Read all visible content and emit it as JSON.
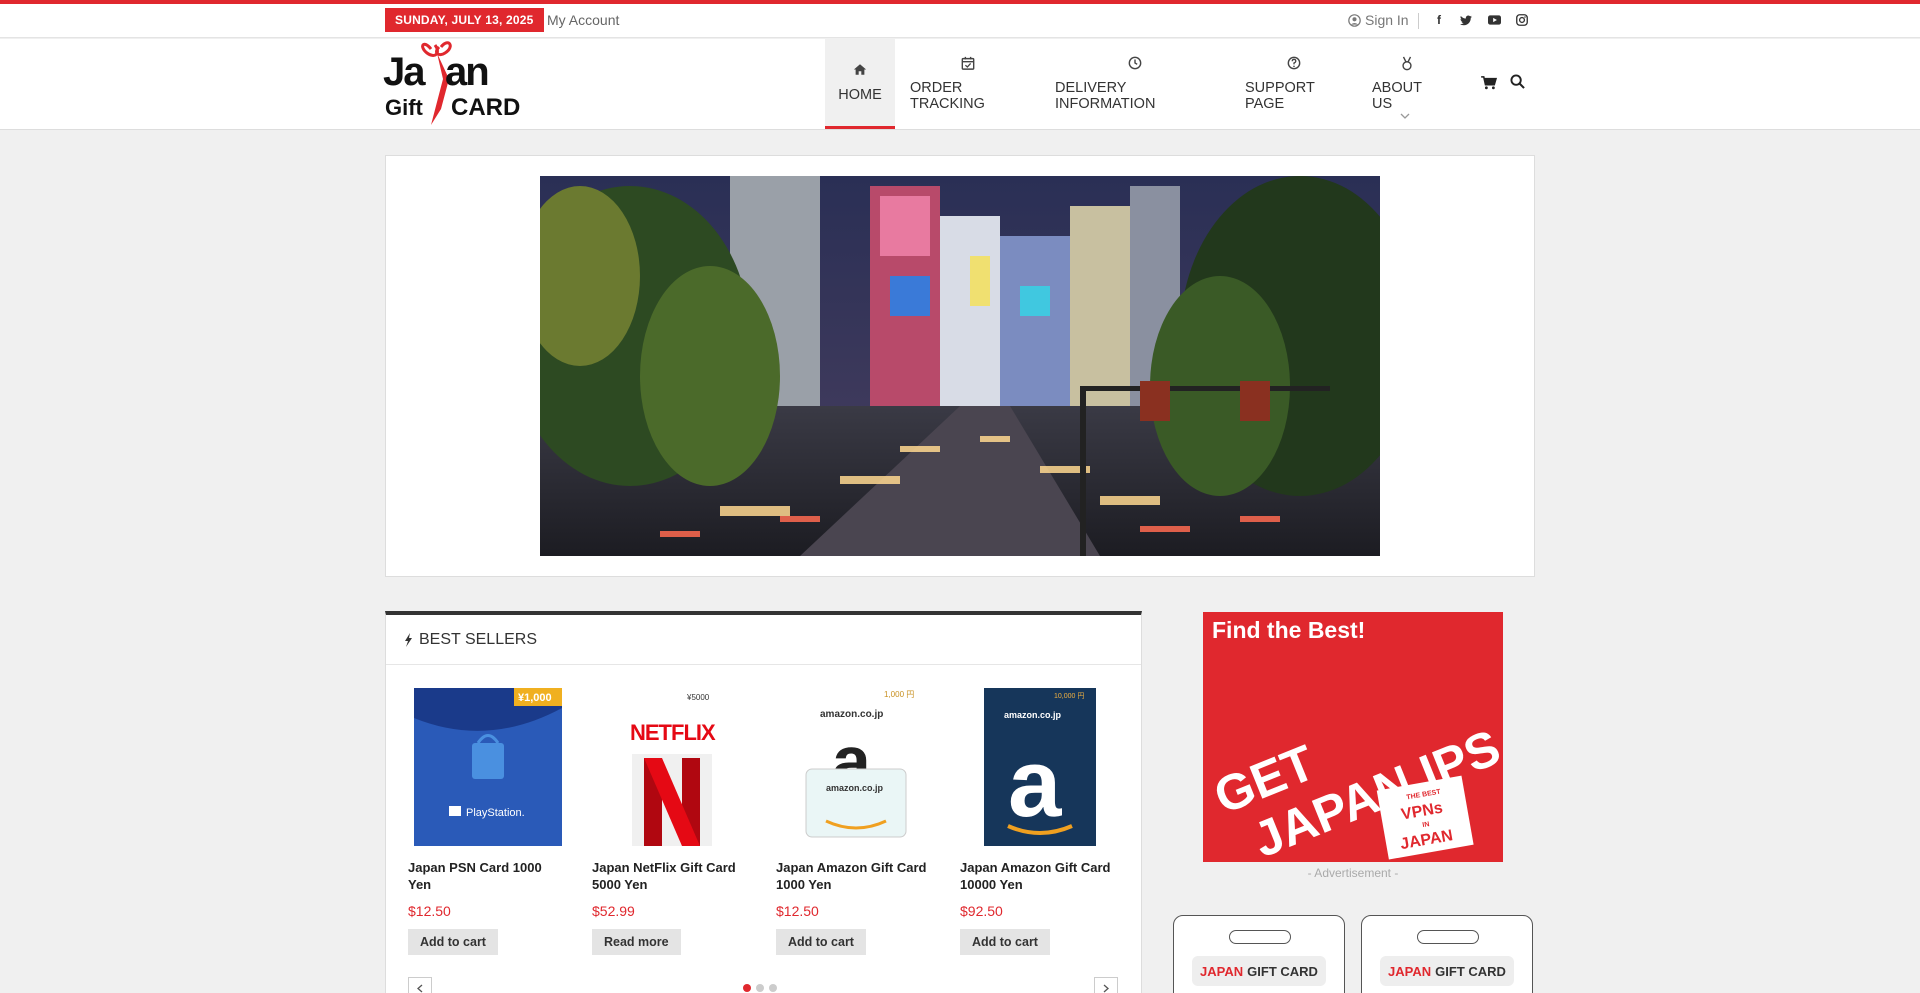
{
  "topbar": {
    "date": "SUNDAY, JULY 13, 2025",
    "my_account": "My Account",
    "sign_in": "Sign In",
    "social": [
      "facebook-icon",
      "twitter-icon",
      "youtube-icon",
      "instagram-icon"
    ]
  },
  "logo": {
    "line1": "Japan",
    "line2_a": "Gift",
    "line2_b": "CARD"
  },
  "nav": {
    "items": [
      {
        "label": "HOME",
        "icon": "home-icon"
      },
      {
        "label": "ORDER TRACKING",
        "icon": "calendar-check-icon"
      },
      {
        "label": "DELIVERY INFORMATION",
        "icon": "clock-icon"
      },
      {
        "label": "SUPPORT PAGE",
        "icon": "question-circle-icon"
      },
      {
        "label": "ABOUT US",
        "icon": "medal-icon"
      }
    ]
  },
  "best_sellers": {
    "title": "BEST SELLERS",
    "products": [
      {
        "name": "Japan PSN Card 1000 Yen",
        "price": "$12.50",
        "button": "Add to cart",
        "badge": "¥1,000"
      },
      {
        "name": "Japan NetFlix Gift Card 5000 Yen",
        "price": "$52.99",
        "button": "Read more",
        "badge": "¥5000"
      },
      {
        "name": "Japan Amazon Gift Card 1000 Yen",
        "price": "$12.50",
        "button": "Add to cart",
        "badge": "1,000 円"
      },
      {
        "name": "Japan Amazon Gift Card 10000 Yen",
        "price": "$92.50",
        "button": "Add to cart",
        "badge": "10,000 円"
      }
    ]
  },
  "ad": {
    "headline": "Find the Best!",
    "line1": "GET",
    "line2": "JAPAN IPS",
    "tag1": "THE BEST",
    "tag2": "VPNs",
    "tag3": "IN",
    "tag4": "JAPAN",
    "caption": "- Advertisement -"
  },
  "gift_cards": [
    {
      "red": "JAPAN",
      "rest": "GIFT CARD"
    },
    {
      "red": "JAPAN",
      "rest": "GIFT CARD"
    }
  ],
  "colors": {
    "accent": "#e0282e"
  }
}
